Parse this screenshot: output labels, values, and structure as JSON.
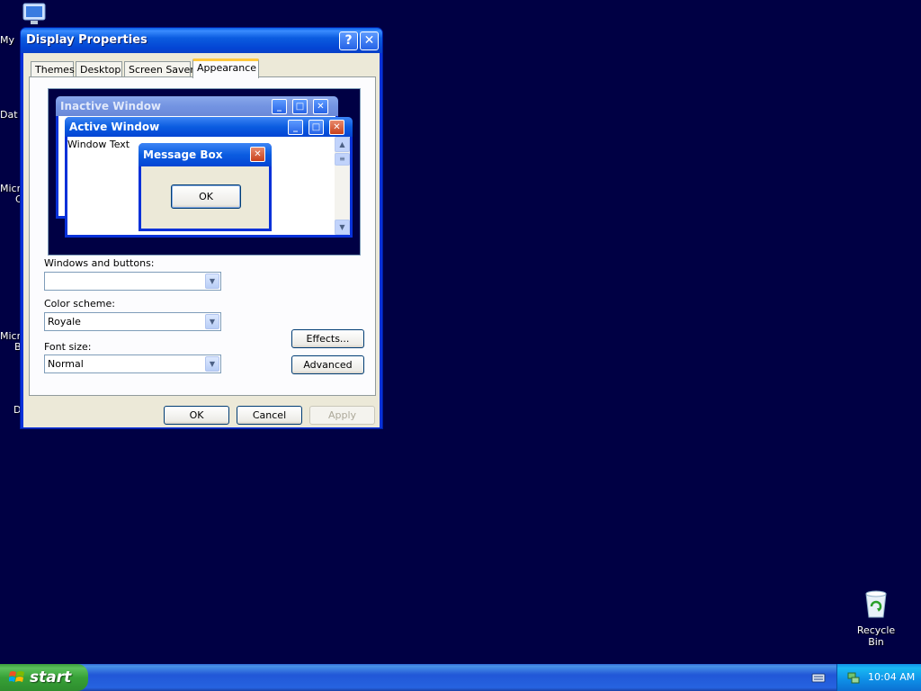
{
  "desktop": {
    "labels": [
      "My",
      "Dat",
      "Micr",
      "C",
      "Micr",
      "B",
      "D"
    ],
    "recycle_bin": "Recycle Bin"
  },
  "window": {
    "title": "Display Properties",
    "help_label": "?",
    "close_label": "✕",
    "tabs": [
      "Themes",
      "Desktop",
      "Screen Saver",
      "Appearance"
    ],
    "active_tab": "Appearance",
    "preview": {
      "inactive_title": "Inactive Window",
      "active_title": "Active Window",
      "window_text": "Window Text",
      "msgbox_title": "Message Box",
      "msgbox_ok": "OK"
    },
    "fields": {
      "windows_buttons_label": "Windows and buttons:",
      "windows_buttons_value": "",
      "color_scheme_label": "Color scheme:",
      "color_scheme_value": "Royale",
      "font_size_label": "Font size:",
      "font_size_value": "Normal"
    },
    "buttons": {
      "effects": "Effects...",
      "advanced": "Advanced",
      "ok": "OK",
      "cancel": "Cancel",
      "apply": "Apply"
    }
  },
  "taskbar": {
    "start_label": "start",
    "clock": "10:04 AM"
  },
  "colors": {
    "desktop": "#000044",
    "title_blue": "#0a5fe8",
    "dialog_face": "#ece9d8",
    "start_green": "#37a137"
  }
}
